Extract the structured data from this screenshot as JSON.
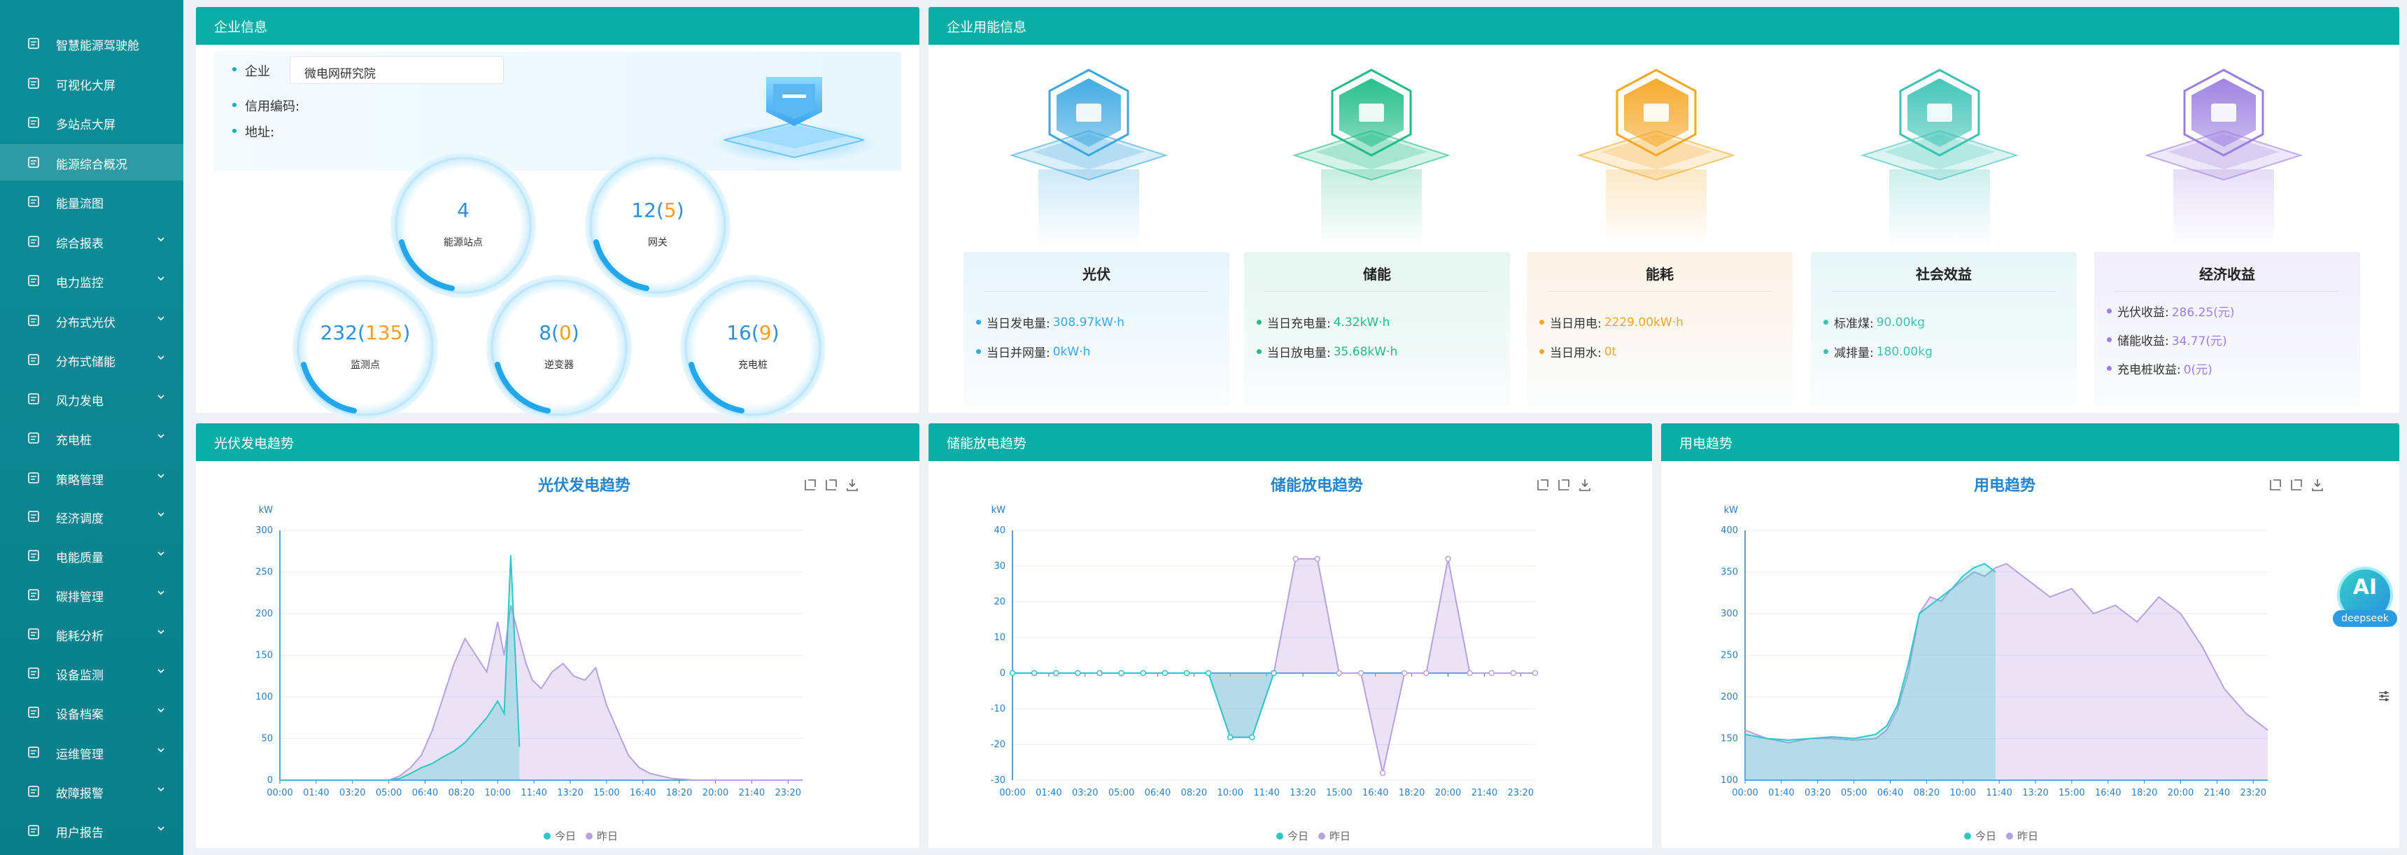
{
  "sidebar": {
    "items": [
      {
        "label": "智慧能源驾驶舱",
        "icon": "monitor-icon",
        "chevron": false,
        "active": false
      },
      {
        "label": "可视化大屏",
        "icon": "chart-screen-icon",
        "chevron": false,
        "active": false
      },
      {
        "label": "多站点大屏",
        "icon": "multi-screen-icon",
        "chevron": false,
        "active": false
      },
      {
        "label": "能源综合概况",
        "icon": "overview-icon",
        "chevron": false,
        "active": true
      },
      {
        "label": "能量流图",
        "icon": "flow-icon",
        "chevron": false,
        "active": false
      },
      {
        "label": "综合报表",
        "icon": "report-icon",
        "chevron": true,
        "active": false
      },
      {
        "label": "电力监控",
        "icon": "power-monitor-icon",
        "chevron": true,
        "active": false
      },
      {
        "label": "分布式光伏",
        "icon": "solar-grid-icon",
        "chevron": true,
        "active": false
      },
      {
        "label": "分布式储能",
        "icon": "storage-icon",
        "chevron": true,
        "active": false
      },
      {
        "label": "风力发电",
        "icon": "wind-icon",
        "chevron": true,
        "active": false
      },
      {
        "label": "充电桩",
        "icon": "charger-icon",
        "chevron": true,
        "active": false
      },
      {
        "label": "策略管理",
        "icon": "strategy-icon",
        "chevron": true,
        "active": false
      },
      {
        "label": "经济调度",
        "icon": "dispatch-icon",
        "chevron": true,
        "active": false
      },
      {
        "label": "电能质量",
        "icon": "quality-icon",
        "chevron": true,
        "active": false
      },
      {
        "label": "碳排管理",
        "icon": "carbon-icon",
        "chevron": true,
        "active": false
      },
      {
        "label": "能耗分析",
        "icon": "analysis-icon",
        "chevron": true,
        "active": false
      },
      {
        "label": "设备监测",
        "icon": "device-monitor-icon",
        "chevron": true,
        "active": false
      },
      {
        "label": "设备档案",
        "icon": "archive-icon",
        "chevron": true,
        "active": false
      },
      {
        "label": "运维管理",
        "icon": "maintenance-icon",
        "chevron": true,
        "active": false
      },
      {
        "label": "故障报警",
        "icon": "alarm-icon",
        "chevron": true,
        "active": false
      },
      {
        "label": "用户报告",
        "icon": "user-report-icon",
        "chevron": true,
        "active": false
      }
    ]
  },
  "company": {
    "panel_title": "企业信息",
    "enterprise_label": "企业",
    "enterprise_value": "微电网研究院",
    "credit_label": "信用编码:",
    "address_label": "地址:",
    "stats": [
      {
        "value": "4",
        "sub": "",
        "label": "能源站点"
      },
      {
        "value": "12",
        "sub": "5",
        "label": "网关"
      },
      {
        "value": "232",
        "sub": "135",
        "label": "监测点"
      },
      {
        "value": "8",
        "sub": "0",
        "label": "逆变器"
      },
      {
        "value": "16",
        "sub": "9",
        "label": "充电桩"
      }
    ]
  },
  "energy": {
    "panel_title": "企业用能信息",
    "cards": [
      {
        "title": "光伏",
        "icon": "solar-panel-icon",
        "accent": "#3aa7e0",
        "value_color": "#3aa7e0",
        "bg": "#e8f6fc",
        "rows": [
          {
            "label": "当日发电量:",
            "value": "308.97kW·h"
          },
          {
            "label": "当日并网量:",
            "value": "0kW·h"
          }
        ]
      },
      {
        "title": "储能",
        "icon": "battery-icon",
        "accent": "#1ebc86",
        "value_color": "#1ebc86",
        "bg": "#e6f7f1",
        "rows": [
          {
            "label": "当日充电量:",
            "value": "4.32kW·h"
          },
          {
            "label": "当日放电量:",
            "value": "35.68kW·h"
          }
        ]
      },
      {
        "title": "能耗",
        "icon": "lightning-icon",
        "accent": "#f5a623",
        "value_color": "#f5a623",
        "bg": "#fdf3e6",
        "rows": [
          {
            "label": "当日用电:",
            "value": "2229.00kW·h"
          },
          {
            "label": "当日用水:",
            "value": "0t"
          }
        ]
      },
      {
        "title": "社会效益",
        "icon": "plant-hand-icon",
        "accent": "#3cc2b4",
        "value_color": "#3cc2b4",
        "bg": "#e7f7f5",
        "rows": [
          {
            "label": "标准煤:",
            "value": "90.00kg"
          },
          {
            "label": "减排量:",
            "value": "180.00kg"
          }
        ]
      },
      {
        "title": "经济收益",
        "icon": "money-bag-icon",
        "accent": "#9b7fe0",
        "value_color": "#9b7fe0",
        "bg": "#f1eefb",
        "rows": [
          {
            "label": "光伏收益:",
            "value": "286.25(元)"
          },
          {
            "label": "储能收益:",
            "value": "34.77(元)"
          },
          {
            "label": "充电桩收益:",
            "value": "0(元)"
          }
        ]
      }
    ]
  },
  "charts": [
    {
      "panel_title": "光伏发电趋势",
      "title": "光伏发电趋势"
    },
    {
      "panel_title": "储能放电趋势",
      "title": "储能放电趋势"
    },
    {
      "panel_title": "用电趋势",
      "title": "用电趋势"
    }
  ],
  "legend": {
    "today": "今日",
    "yesterday": "昨日"
  },
  "colors": {
    "today": "#2ec7c9",
    "yesterday": "#b6a2de",
    "header": "#0aaea7",
    "sidebar": "#0c8e99"
  },
  "ai_badge": {
    "title": "AI",
    "subtitle": "deepseek"
  },
  "chart_data": [
    {
      "type": "area",
      "title": "光伏发电趋势",
      "ylabel": "kW",
      "ylim": [
        0,
        300
      ],
      "yticks": [
        0,
        50,
        100,
        150,
        200,
        250,
        300
      ],
      "xticks": [
        "00:00",
        "01:40",
        "03:20",
        "05:00",
        "06:40",
        "08:20",
        "10:00",
        "11:40",
        "13:20",
        "15:00",
        "16:40",
        "18:20",
        "20:00",
        "21:40",
        "23:20"
      ],
      "x_hours": [
        0,
        1,
        2,
        3,
        4,
        5,
        5.5,
        6,
        6.5,
        7,
        7.5,
        8,
        8.5,
        9,
        9.5,
        10,
        10.3,
        10.6,
        11,
        11.3,
        11.6,
        12,
        12.5,
        13,
        13.5,
        14,
        14.5,
        15,
        15.5,
        16,
        16.5,
        17,
        17.5,
        18,
        19,
        20,
        21,
        22,
        23,
        24
      ],
      "series": [
        {
          "name": "今日",
          "values": [
            0,
            0,
            0,
            0,
            0,
            0,
            2,
            8,
            15,
            20,
            28,
            35,
            45,
            60,
            75,
            95,
            80,
            270,
            40,
            null,
            null,
            null,
            null,
            null,
            null,
            null,
            null,
            null,
            null,
            null,
            null,
            null,
            null,
            null,
            null,
            null,
            null,
            null,
            null,
            null
          ]
        },
        {
          "name": "昨日",
          "values": [
            0,
            0,
            0,
            0,
            0,
            0,
            5,
            15,
            30,
            60,
            100,
            140,
            170,
            150,
            130,
            190,
            150,
            210,
            170,
            140,
            120,
            110,
            130,
            140,
            125,
            120,
            135,
            90,
            60,
            30,
            15,
            8,
            5,
            2,
            0,
            0,
            0,
            0,
            0,
            0
          ]
        }
      ]
    },
    {
      "type": "area",
      "title": "储能放电趋势",
      "ylabel": "kW",
      "ylim": [
        -30,
        40
      ],
      "yticks": [
        -30,
        -20,
        -10,
        0,
        10,
        20,
        30,
        40
      ],
      "xticks": [
        "00:00",
        "01:40",
        "03:20",
        "05:00",
        "06:40",
        "08:20",
        "10:00",
        "11:40",
        "13:20",
        "15:00",
        "16:40",
        "18:20",
        "20:00",
        "21:40",
        "23:20"
      ],
      "x_hours": [
        0,
        1,
        2,
        3,
        4,
        5,
        6,
        7,
        8,
        9,
        10,
        11,
        12,
        13,
        14,
        15,
        16,
        17,
        18,
        19,
        20,
        21,
        22,
        23,
        24
      ],
      "series": [
        {
          "name": "今日",
          "values": [
            0,
            0,
            0,
            0,
            0,
            0,
            0,
            0,
            0,
            0,
            -18,
            -18,
            0,
            null,
            null,
            null,
            null,
            null,
            null,
            null,
            null,
            null,
            null,
            null,
            null
          ]
        },
        {
          "name": "昨日",
          "values": [
            0,
            0,
            0,
            0,
            0,
            0,
            0,
            0,
            0,
            0,
            -18,
            -18,
            0,
            32,
            32,
            0,
            0,
            -28,
            0,
            0,
            32,
            0,
            0,
            0,
            0
          ]
        }
      ]
    },
    {
      "type": "area",
      "title": "用电趋势",
      "ylabel": "kW",
      "ylim": [
        100,
        400
      ],
      "yticks": [
        100,
        150,
        200,
        250,
        300,
        350,
        400
      ],
      "xticks": [
        "00:00",
        "01:40",
        "03:20",
        "05:00",
        "06:40",
        "08:20",
        "10:00",
        "11:40",
        "13:20",
        "15:00",
        "16:40",
        "18:20",
        "20:00",
        "21:40",
        "23:20"
      ],
      "x_hours": [
        0,
        1,
        2,
        3,
        4,
        5,
        6,
        6.5,
        7,
        7.5,
        8,
        8.5,
        9,
        9.5,
        10,
        10.5,
        11,
        11.5,
        12,
        13,
        14,
        15,
        16,
        17,
        18,
        19,
        20,
        21,
        22,
        23,
        24
      ],
      "series": [
        {
          "name": "今日",
          "values": [
            155,
            150,
            148,
            150,
            152,
            150,
            155,
            165,
            190,
            240,
            300,
            310,
            320,
            330,
            345,
            355,
            360,
            350,
            null,
            null,
            null,
            null,
            null,
            null,
            null,
            null,
            null,
            null,
            null,
            null,
            null
          ]
        },
        {
          "name": "昨日",
          "values": [
            160,
            150,
            145,
            150,
            150,
            148,
            150,
            160,
            185,
            230,
            300,
            320,
            315,
            330,
            340,
            350,
            345,
            355,
            360,
            340,
            320,
            330,
            300,
            310,
            290,
            320,
            300,
            260,
            210,
            180,
            160
          ]
        }
      ]
    }
  ]
}
